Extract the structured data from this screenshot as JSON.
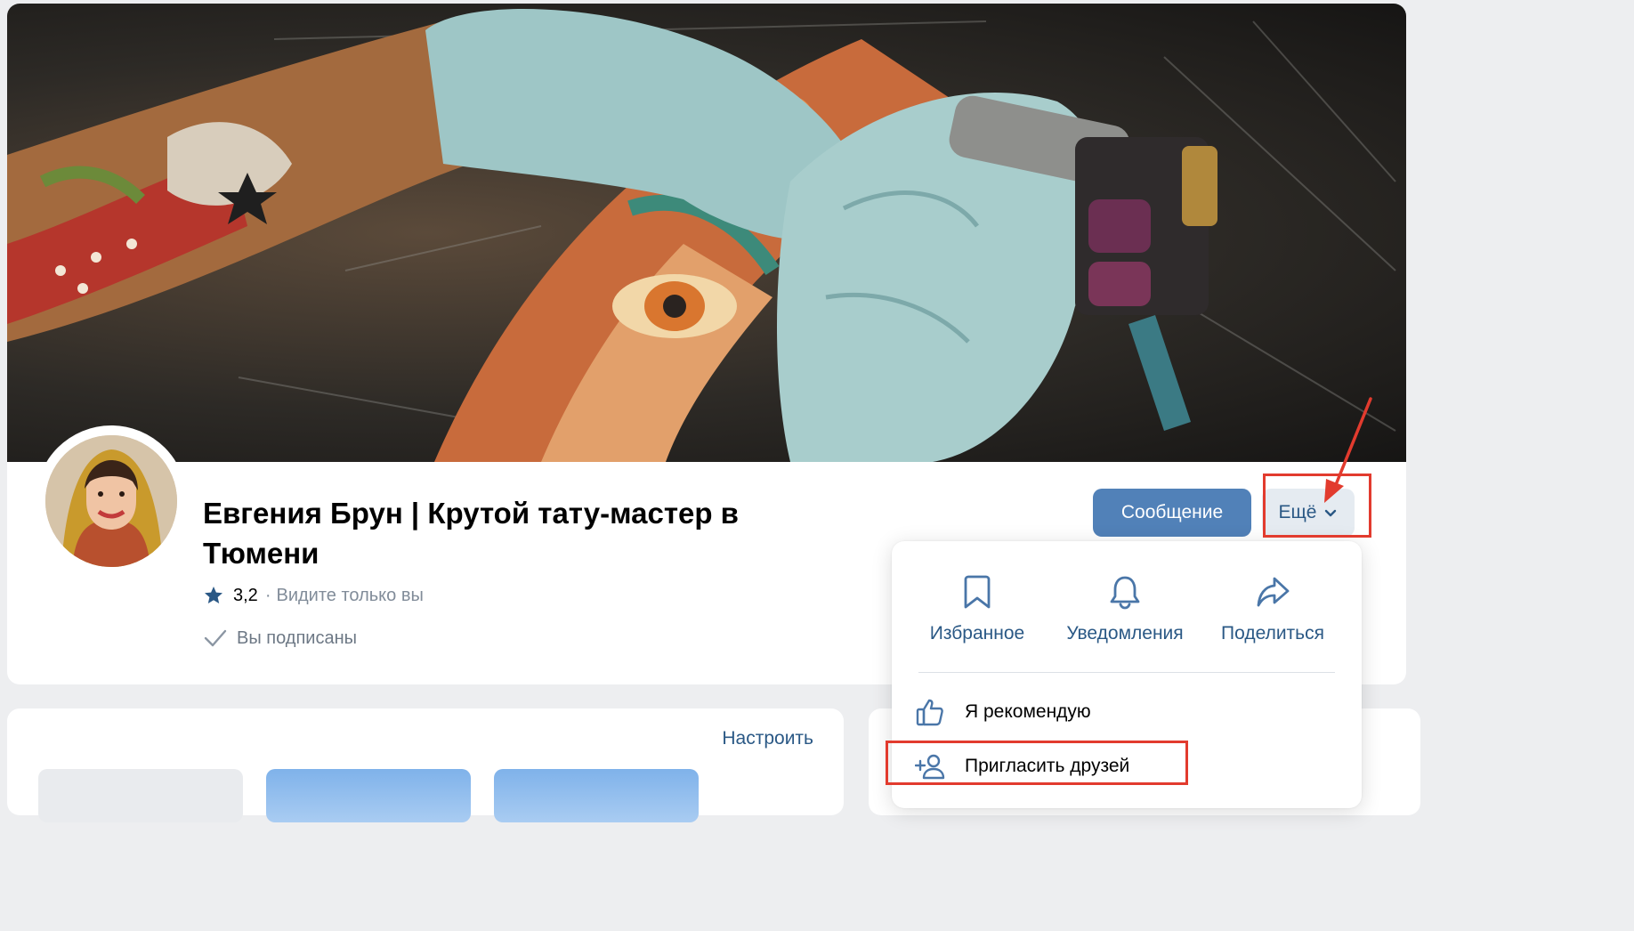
{
  "profile": {
    "name": "Евгения Брун | Крутой тату-мастер в Тюмени",
    "rating": "3,2",
    "separator": "·",
    "visibility": "Видите только вы",
    "subscribed": "Вы подписаны"
  },
  "actions": {
    "message": "Сообщение",
    "more": "Ещё"
  },
  "dropdown": {
    "quick_actions": [
      {
        "label": "Избранное",
        "icon": "bookmark-icon"
      },
      {
        "label": "Уведомления",
        "icon": "bell-icon"
      },
      {
        "label": "Поделиться",
        "icon": "share-icon"
      }
    ],
    "items": [
      {
        "label": "Я рекомендую",
        "icon": "thumbs-up-icon"
      },
      {
        "label": "Пригласить друзей",
        "icon": "add-user-icon"
      }
    ]
  },
  "section": {
    "configure": "Настроить"
  },
  "colors": {
    "primary_button": "#5181b8",
    "secondary_button": "#e5ebf1",
    "link": "#2a5885",
    "annotation": "#e23b2e"
  }
}
